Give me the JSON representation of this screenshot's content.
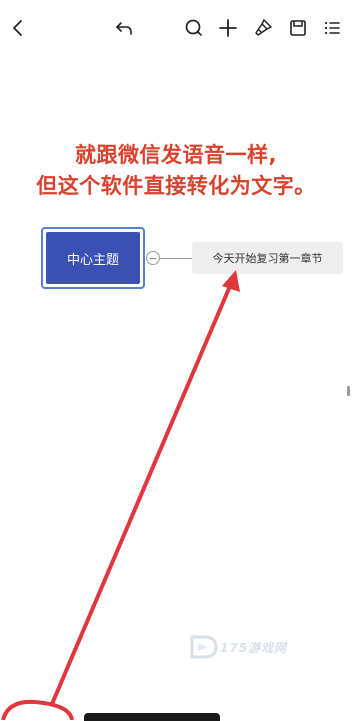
{
  "annotation": {
    "line1": "就跟微信发语音一样,",
    "line2": "但这个软件直接转化为文字。"
  },
  "mindmap": {
    "central_topic": "中心主题",
    "child_topic": "今天开始复习第一章节"
  },
  "watermark": {
    "text": "175游戏网"
  },
  "toolbar": {
    "icons": [
      "back-icon",
      "undo-icon",
      "search-icon",
      "add-icon",
      "format-brush-icon",
      "save-icon",
      "menu-icon"
    ]
  },
  "colors": {
    "annotation_red": "#d8432e",
    "arrow_red": "#e2363f",
    "central_fill": "#3a51b3",
    "central_border": "#5b7fd6",
    "child_fill": "#eeeeee"
  }
}
